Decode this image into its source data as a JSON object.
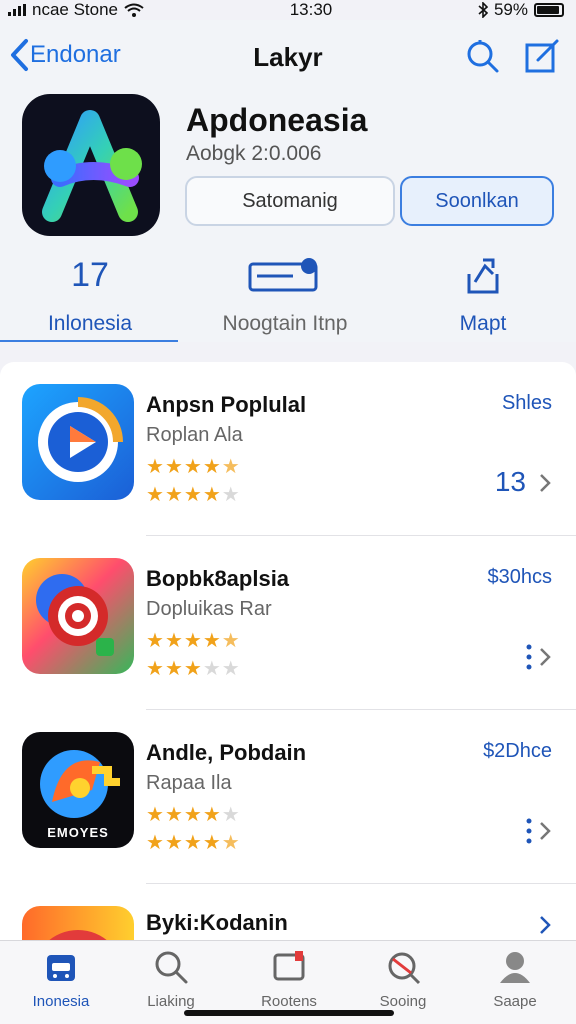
{
  "status_bar": {
    "carrier": "ncae Stone",
    "time": "13:30",
    "battery": "59%"
  },
  "navbar": {
    "back_label": "Endonar",
    "title": "Lakyr"
  },
  "app": {
    "name": "Apdoneasia",
    "subtitle": "Aobgk 2:0.006",
    "button_secondary": "Satomanig",
    "button_primary": "Soonlkan"
  },
  "stats": [
    {
      "value": "17",
      "label": "Inlonesia"
    },
    {
      "value": "",
      "label": "Noogtain Itnp"
    },
    {
      "value": "",
      "label": "Mapt"
    }
  ],
  "rows": [
    {
      "title": "Anpsn Poplulal",
      "subtitle": "Roplan Ala",
      "price": "Shles",
      "count": "13",
      "rating_1": 4.5,
      "rating_2": 4,
      "icon": "play-icon"
    },
    {
      "title": "Bopbk8aplsia",
      "subtitle": "Dopluikas Rar",
      "price": "$30hcs",
      "count": "",
      "rating_1": 4.5,
      "rating_2": 3,
      "icon": "target-game-icon"
    },
    {
      "title": "Andle, Pobdain",
      "subtitle": "Rapaa Ila",
      "price": "$2Dhce",
      "count": "",
      "rating_1": 4,
      "rating_2": 4.5,
      "icon": "emoyes-icon",
      "icon_text": "EMOYES"
    },
    {
      "title": "Byki:Kodanin",
      "subtitle": "",
      "price": "",
      "count": "",
      "icon": "rainbow-icon"
    }
  ],
  "tabs": [
    {
      "label": "Inonesia",
      "icon": "app-store-icon",
      "active": true
    },
    {
      "label": "Liaking",
      "icon": "search-icon",
      "active": false
    },
    {
      "label": "Rootens",
      "icon": "notification-icon",
      "active": false
    },
    {
      "label": "Sooing",
      "icon": "radar-search-icon",
      "active": false
    },
    {
      "label": "Saape",
      "icon": "profile-icon",
      "active": false
    }
  ],
  "colors": {
    "accent": "#1f55b8",
    "star": "#f1a21a"
  }
}
